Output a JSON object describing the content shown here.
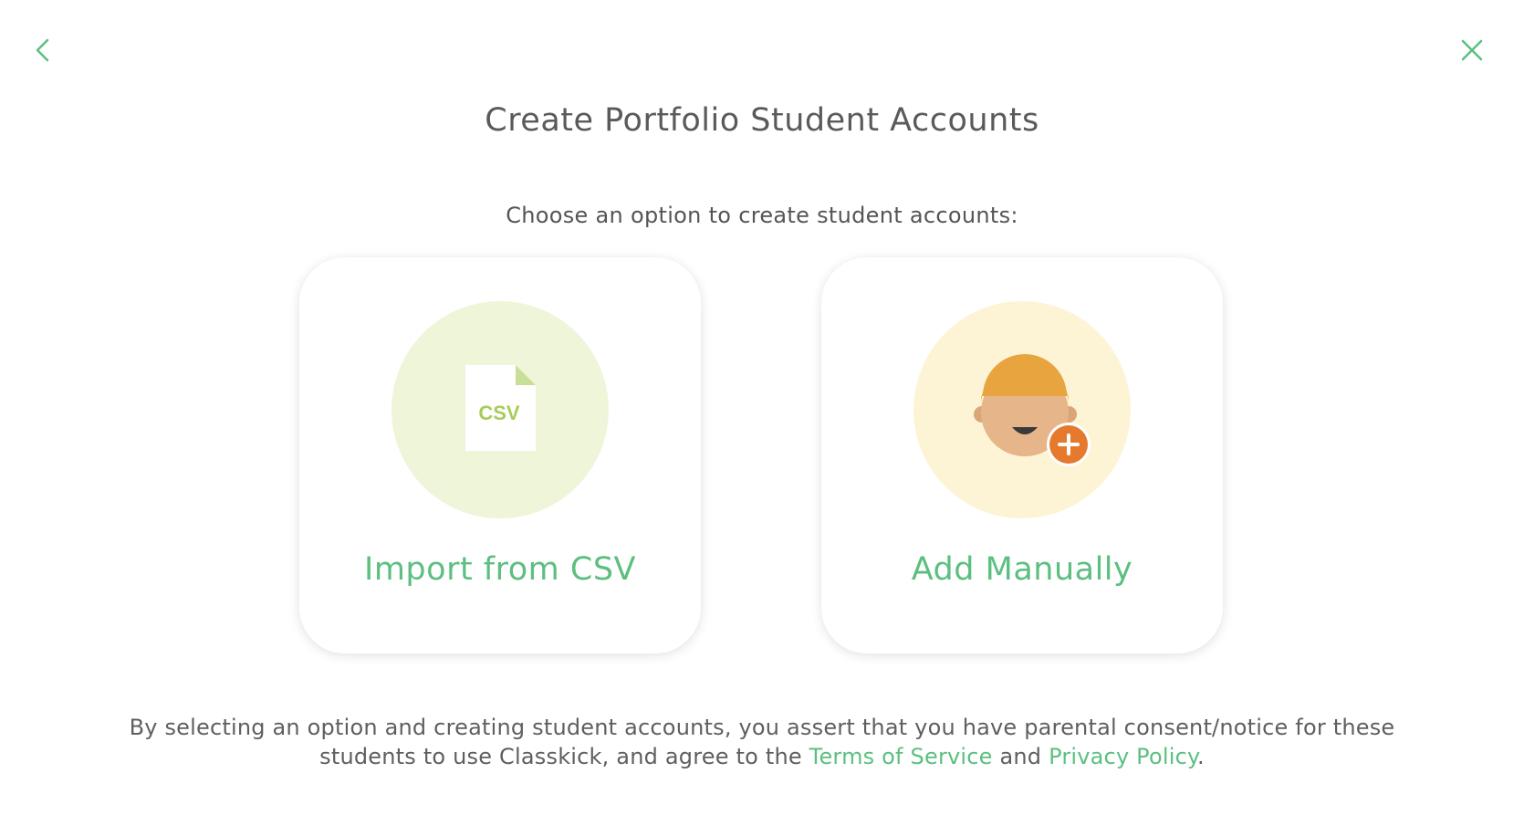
{
  "header": {
    "back_icon": "chevron-left-icon",
    "close_icon": "close-icon",
    "title": "Create Portfolio Student Accounts"
  },
  "main": {
    "subtitle": "Choose an option to create student accounts:",
    "options": [
      {
        "label": "Import from CSV",
        "icon": "csv-file-icon",
        "icon_text": "CSV",
        "circle_color": "#eff5d9"
      },
      {
        "label": "Add Manually",
        "icon": "add-student-icon",
        "circle_color": "#fdf4d6"
      }
    ]
  },
  "footer": {
    "text_1": "By selecting an option and creating student accounts, you assert that you have parental consent/notice for these students to use Classkick, and agree to the ",
    "terms_link": "Terms of Service",
    "text_2": " and ",
    "privacy_link": "Privacy Policy",
    "text_3": "."
  },
  "colors": {
    "accent": "#5cbf80",
    "text": "#5a5a5a",
    "csv_green": "#a8cc5a",
    "orange": "#e57a2e",
    "hair": "#e8a53f",
    "skin": "#e6b58a"
  }
}
